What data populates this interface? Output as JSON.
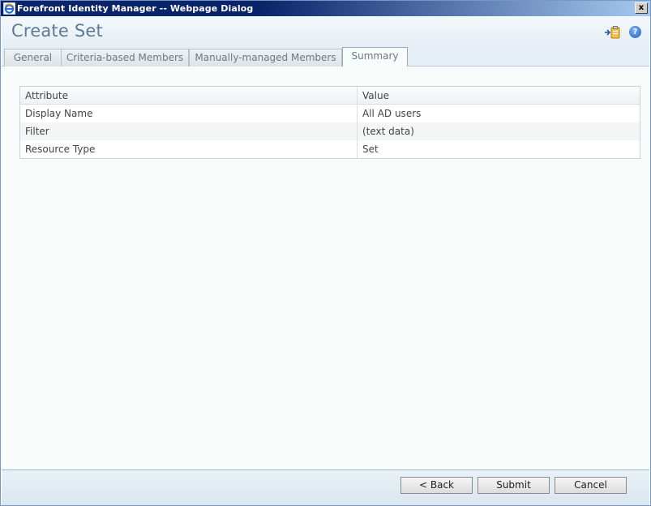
{
  "window": {
    "title": "Forefront Identity Manager -- Webpage Dialog",
    "close_label": "x"
  },
  "header": {
    "page_title": "Create Set",
    "help_glyph": "?"
  },
  "tabs": [
    {
      "label": "General",
      "active": false
    },
    {
      "label": "Criteria-based Members",
      "active": false
    },
    {
      "label": "Manually-managed Members",
      "active": false
    },
    {
      "label": "Summary",
      "active": true
    }
  ],
  "summary_table": {
    "columns": [
      "Attribute",
      "Value"
    ],
    "rows": [
      {
        "attribute": "Display Name",
        "value": "All AD users"
      },
      {
        "attribute": "Filter",
        "value": "(text data)"
      },
      {
        "attribute": "Resource Type",
        "value": "Set"
      }
    ]
  },
  "footer": {
    "back_label": "< Back",
    "submit_label": "Submit",
    "cancel_label": "Cancel"
  },
  "icons": {
    "app": "ie-icon",
    "export": "export-icon",
    "help": "help-icon"
  }
}
